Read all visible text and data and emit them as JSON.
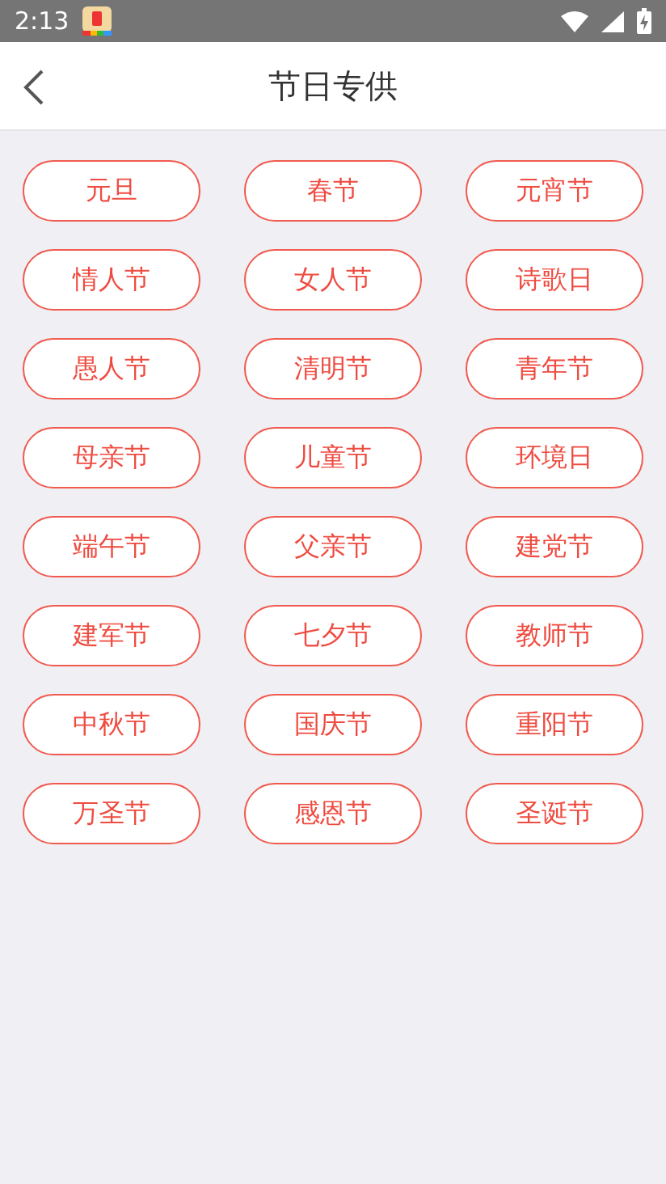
{
  "status_bar": {
    "time": "2:13"
  },
  "header": {
    "title": "节日专供"
  },
  "holidays": [
    {
      "label": "元旦"
    },
    {
      "label": "春节"
    },
    {
      "label": "元宵节"
    },
    {
      "label": "情人节"
    },
    {
      "label": "女人节"
    },
    {
      "label": "诗歌日"
    },
    {
      "label": "愚人节"
    },
    {
      "label": "清明节"
    },
    {
      "label": "青年节"
    },
    {
      "label": "母亲节"
    },
    {
      "label": "儿童节"
    },
    {
      "label": "环境日"
    },
    {
      "label": "端午节"
    },
    {
      "label": "父亲节"
    },
    {
      "label": "建党节"
    },
    {
      "label": "建军节"
    },
    {
      "label": "七夕节"
    },
    {
      "label": "教师节"
    },
    {
      "label": "中秋节"
    },
    {
      "label": "国庆节"
    },
    {
      "label": "重阳节"
    },
    {
      "label": "万圣节"
    },
    {
      "label": "感恩节"
    },
    {
      "label": "圣诞节"
    }
  ]
}
